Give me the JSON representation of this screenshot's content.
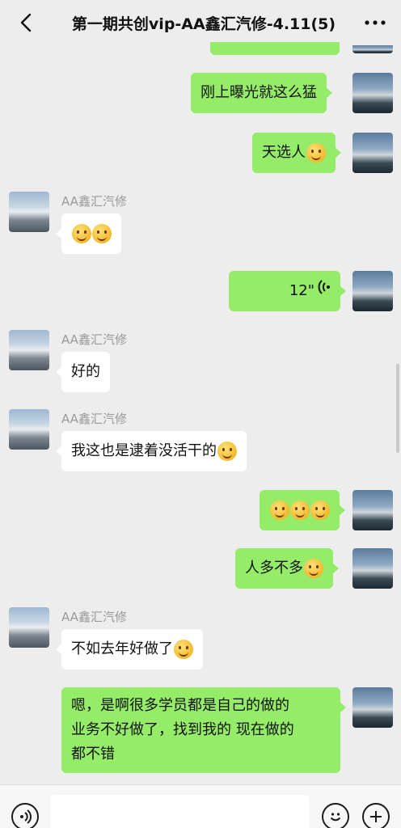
{
  "header": {
    "back_icon": "chevron-left-icon",
    "title": "第一期共创vip-AA鑫汇汽修-4.11(5)",
    "more_icon": "more-dots-icon"
  },
  "colors": {
    "sent_bubble": "#95ec69",
    "received_bubble": "#ffffff",
    "background": "#ededed"
  },
  "messages": [
    {
      "from": "me",
      "text": "刚上曝光就这么猛",
      "emoji": []
    },
    {
      "from": "me",
      "text": "天选人",
      "emoji": [
        "grin-emoji"
      ]
    },
    {
      "from": "other",
      "sender": "AA鑫汇汽修",
      "text": "",
      "emoji": [
        "tears-of-joy-emoji",
        "tears-of-joy-emoji"
      ]
    },
    {
      "from": "me",
      "type": "voice",
      "text": "12\"",
      "emoji": []
    },
    {
      "from": "other",
      "sender": "AA鑫汇汽修",
      "text": "好的",
      "emoji": []
    },
    {
      "from": "other",
      "sender": "AA鑫汇汽修",
      "text": "我这也是逮着没活干的",
      "emoji": [
        "hand-over-mouth-emoji"
      ]
    },
    {
      "from": "me",
      "text": "",
      "emoji": [
        "666-emoji",
        "666-emoji",
        "666-emoji"
      ]
    },
    {
      "from": "me",
      "text": "人多不多",
      "emoji": [
        "hand-over-mouth-emoji"
      ]
    },
    {
      "from": "other",
      "sender": "AA鑫汇汽修",
      "text": "不如去年好做了",
      "emoji": [
        "pensive-emoji"
      ]
    },
    {
      "from": "me",
      "text_lines": [
        "嗯，是啊很多学员都是自己的做的",
        "业务不好做了，找到我的 现在做的",
        "都不错"
      ],
      "emoji": []
    }
  ],
  "bottom": {
    "voice_icon": "voice-input-icon",
    "emoji_icon": "emoji-icon",
    "plus_icon": "plus-icon"
  }
}
